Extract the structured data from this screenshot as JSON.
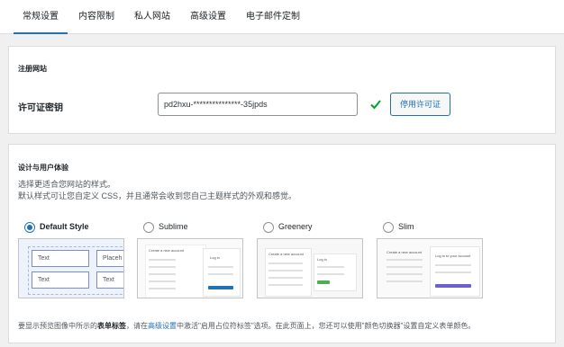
{
  "tabs": [
    "常规设置",
    "内容限制",
    "私人网站",
    "高级设置",
    "电子邮件定制"
  ],
  "registration": {
    "section_title": "注册网站",
    "license_label": "许可证密钥",
    "license_value": "pd2hxu-***************-35jpds",
    "deactivate_label": "停用许可证"
  },
  "design": {
    "section_title": "设计与用户体验",
    "desc_line1": "选择更适合您网站的样式。",
    "desc_line2": "默认样式可让您自定义 CSS，并且通常会收到您自己主题样式的外观和感觉。",
    "styles": [
      {
        "name": "Default Style",
        "selected": true
      },
      {
        "name": "Sublime",
        "selected": false
      },
      {
        "name": "Greenery",
        "selected": false
      },
      {
        "name": "Slim",
        "selected": false
      }
    ],
    "default_preview_fields": [
      "Text",
      "Placeh",
      "Text",
      "Text"
    ],
    "sublime_preview": {
      "title": "Create a new account",
      "login": "Log in"
    },
    "greenery_preview": {
      "title": "Create a new account",
      "login": "Log in"
    },
    "slim_preview": {
      "title": "Create a new account",
      "login": "Log in to your account"
    },
    "footer": {
      "part1": "要显示预览图像中所示的",
      "bold": "表单标签",
      "part2": "，请在",
      "link": "高级设置",
      "part3": "中激活\"启用占位符标签\"选项。在此页面上，您还可以使用\"颜色切换器\"设置自定义表单颜色。"
    },
    "colors": {
      "accent": "#2271b1",
      "green": "#00a32a",
      "greenery": "#4caf50",
      "slim": "#6c5fcf"
    }
  }
}
